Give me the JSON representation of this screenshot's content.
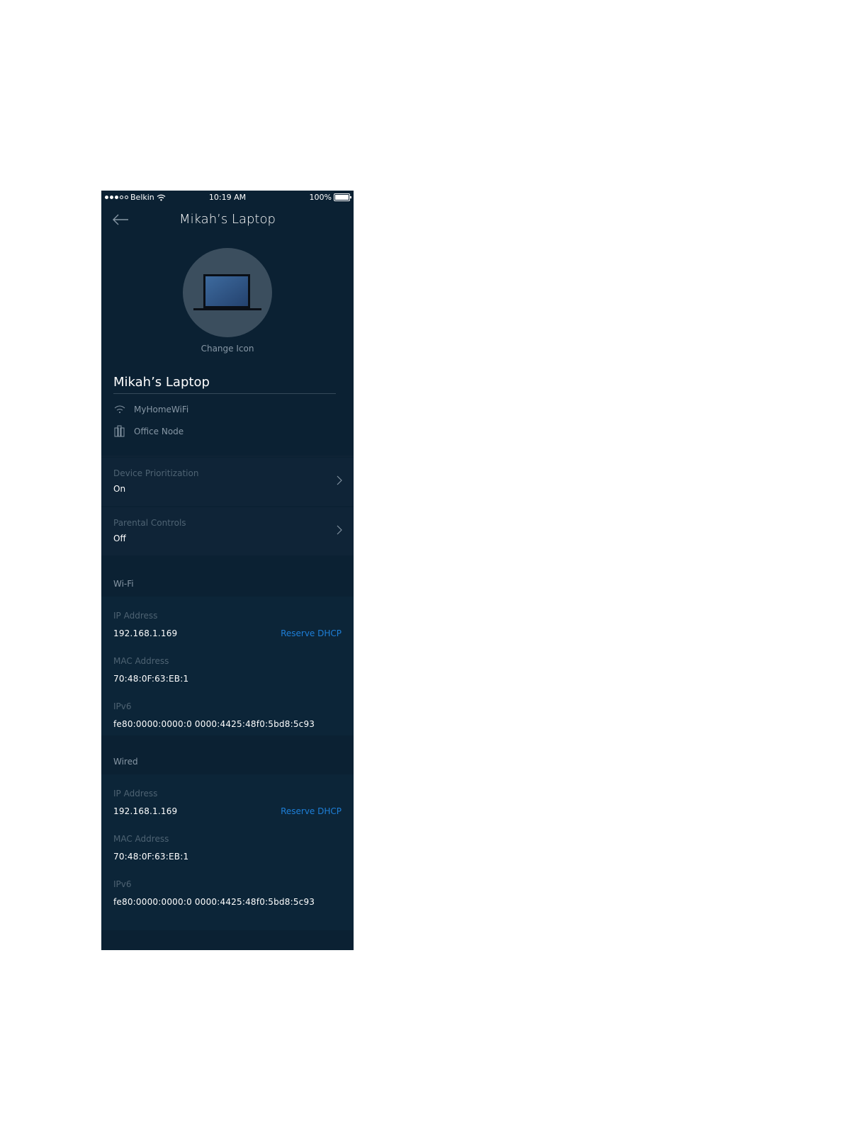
{
  "status_bar": {
    "carrier": "Belkin",
    "time": "10:19 AM",
    "battery": "100%"
  },
  "header": {
    "title": "Mikah’s Laptop"
  },
  "device": {
    "change_icon_label": "Change Icon",
    "name": "Mikah’s Laptop",
    "network": "MyHomeWiFi",
    "node": "Office Node"
  },
  "settings": [
    {
      "label": "Device Prioritization",
      "value": "On"
    },
    {
      "label": "Parental Controls",
      "value": "Off"
    }
  ],
  "wifi": {
    "heading": "Wi-Fi",
    "ip_label": "IP Address",
    "ip_value": "192.168.1.169",
    "reserve_label": "Reserve DHCP",
    "mac_label": "MAC Address",
    "mac_value": "70:48:0F:63:EB:1",
    "ipv6_label": "IPv6",
    "ipv6_value": "fe80:0000:0000:0 0000:4425:48f0:5bd8:5c93"
  },
  "wired": {
    "heading": "Wired",
    "ip_label": "IP Address",
    "ip_value": "192.168.1.169",
    "reserve_label": "Reserve DHCP",
    "mac_label": "MAC Address",
    "mac_value": "70:48:0F:63:EB:1",
    "ipv6_label": "IPv6",
    "ipv6_value": "fe80:0000:0000:0 0000:4425:48f0:5bd8:5c93"
  },
  "colors": {
    "background": "#0b2133",
    "card": "#0f2437",
    "link": "#1e7fd8",
    "avatar_circle": "#3b4e5e"
  }
}
